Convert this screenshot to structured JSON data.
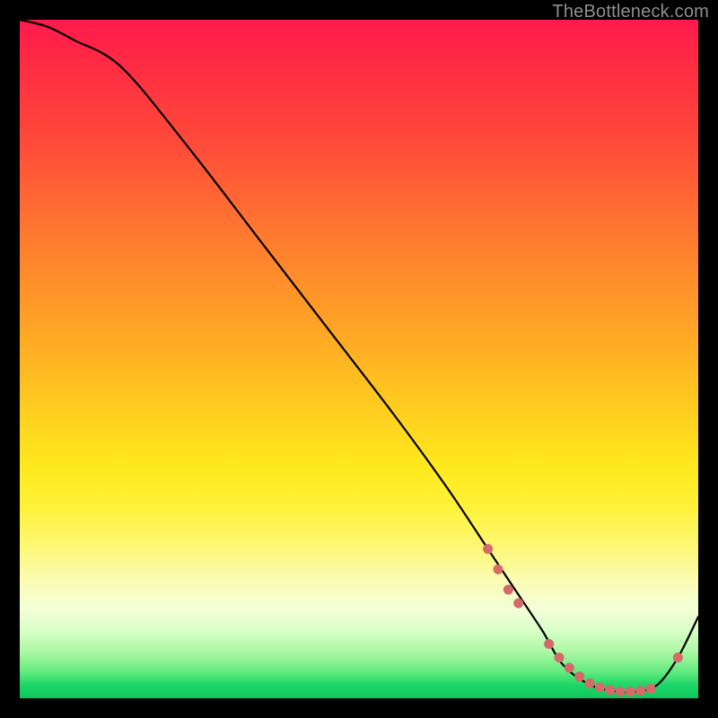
{
  "watermark": "TheBottleneck.com",
  "chart_data": {
    "type": "line",
    "title": "",
    "xlabel": "",
    "ylabel": "",
    "xlim": [
      0,
      100
    ],
    "ylim": [
      0,
      100
    ],
    "series": [
      {
        "name": "bottleneck-curve",
        "x": [
          0,
          4,
          8,
          15,
          25,
          35,
          45,
          55,
          63,
          69,
          73,
          77,
          80,
          84,
          88,
          91,
          94,
          97,
          100
        ],
        "values": [
          100,
          99,
          97,
          93,
          81,
          68,
          55,
          42,
          31,
          22,
          16,
          10,
          5,
          2,
          1,
          1,
          2,
          6,
          12
        ]
      }
    ],
    "marker_series": {
      "name": "highlighted-points",
      "color": "#d46a6a",
      "x": [
        69,
        70.5,
        72,
        73.5,
        78,
        79.5,
        81,
        82.5,
        84,
        85.5,
        87,
        88.5,
        90,
        91.5,
        93,
        97
      ],
      "values": [
        22,
        19,
        16,
        14,
        8,
        6,
        4.5,
        3.2,
        2.2,
        1.6,
        1.2,
        1.0,
        1.0,
        1.1,
        1.4,
        6
      ]
    }
  }
}
